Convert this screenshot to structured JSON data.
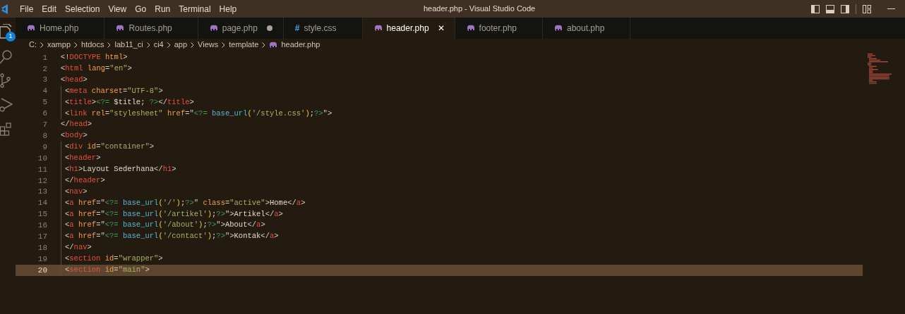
{
  "window": {
    "title": "header.php - Visual Studio Code"
  },
  "menu": [
    "File",
    "Edit",
    "Selection",
    "View",
    "Go",
    "Run",
    "Terminal",
    "Help"
  ],
  "activity_bar": {
    "badge": "1"
  },
  "tabs": [
    {
      "label": "Home.php",
      "kind": "php",
      "selected": false,
      "modified": false
    },
    {
      "label": "Routes.php",
      "kind": "php",
      "selected": false,
      "modified": false
    },
    {
      "label": "page.php",
      "kind": "php",
      "selected": false,
      "modified": true
    },
    {
      "label": "style.css",
      "kind": "css",
      "glyph": "#",
      "selected": false,
      "modified": false
    },
    {
      "label": "header.php",
      "kind": "php",
      "selected": true,
      "modified": false,
      "close": "✕"
    },
    {
      "label": "footer.php",
      "kind": "php",
      "selected": false,
      "modified": false
    },
    {
      "label": "about.php",
      "kind": "php",
      "selected": false,
      "modified": false
    }
  ],
  "breadcrumbs": [
    "C:",
    "xampp",
    "htdocs",
    "lab11_ci",
    "ci4",
    "app",
    "Views",
    "template",
    "header.php"
  ],
  "lines": [
    {
      "number": "1",
      "indented": false,
      "selected": false,
      "tokens": [
        {
          "kind": "punct",
          "text": "<!"
        },
        {
          "kind": "tag",
          "text": "DOCTYPE"
        },
        {
          "kind": "attr",
          "text": " html"
        },
        {
          "kind": "punct",
          "text": ">"
        }
      ]
    },
    {
      "number": "2",
      "indented": false,
      "selected": false,
      "tokens": [
        {
          "kind": "punct",
          "text": "<"
        },
        {
          "kind": "tag",
          "text": "html"
        },
        {
          "kind": "attr",
          "text": " lang"
        },
        {
          "kind": "punct",
          "text": "="
        },
        {
          "kind": "string",
          "text": "\"en\""
        },
        {
          "kind": "punct",
          "text": ">"
        }
      ]
    },
    {
      "number": "3",
      "indented": false,
      "selected": false,
      "tokens": [
        {
          "kind": "punct",
          "text": "<"
        },
        {
          "kind": "tag",
          "text": "head"
        },
        {
          "kind": "punct",
          "text": ">"
        }
      ]
    },
    {
      "number": "4",
      "indented": true,
      "selected": false,
      "tokens": [
        {
          "kind": "punct",
          "text": "<"
        },
        {
          "kind": "tag",
          "text": "meta"
        },
        {
          "kind": "attr",
          "text": " charset"
        },
        {
          "kind": "punct",
          "text": "="
        },
        {
          "kind": "string",
          "text": "\"UTF-8\""
        },
        {
          "kind": "punct",
          "text": ">"
        }
      ]
    },
    {
      "number": "5",
      "indented": true,
      "selected": false,
      "tokens": [
        {
          "kind": "punct",
          "text": "<"
        },
        {
          "kind": "tag",
          "text": "title"
        },
        {
          "kind": "punct",
          "text": ">"
        },
        {
          "kind": "php",
          "text": "<?="
        },
        {
          "kind": "text",
          "text": " $title; "
        },
        {
          "kind": "php",
          "text": "?>"
        },
        {
          "kind": "punct",
          "text": "</"
        },
        {
          "kind": "tag",
          "text": "title"
        },
        {
          "kind": "punct",
          "text": ">"
        }
      ]
    },
    {
      "number": "6",
      "indented": true,
      "selected": false,
      "tokens": [
        {
          "kind": "punct",
          "text": "<"
        },
        {
          "kind": "tag",
          "text": "link"
        },
        {
          "kind": "attr",
          "text": " rel"
        },
        {
          "kind": "punct",
          "text": "="
        },
        {
          "kind": "string",
          "text": "\"stylesheet\""
        },
        {
          "kind": "attr",
          "text": " href"
        },
        {
          "kind": "punct",
          "text": "=\""
        },
        {
          "kind": "php",
          "text": "<?="
        },
        {
          "kind": "func",
          "text": " base_url"
        },
        {
          "kind": "paren",
          "text": "("
        },
        {
          "kind": "string",
          "text": "'/style.css'"
        },
        {
          "kind": "paren",
          "text": ")"
        },
        {
          "kind": "text",
          "text": ";"
        },
        {
          "kind": "php",
          "text": "?>"
        },
        {
          "kind": "punct",
          "text": "\">"
        }
      ]
    },
    {
      "number": "7",
      "indented": false,
      "selected": false,
      "tokens": [
        {
          "kind": "punct",
          "text": "</"
        },
        {
          "kind": "tag",
          "text": "head"
        },
        {
          "kind": "punct",
          "text": ">"
        }
      ]
    },
    {
      "number": "8",
      "indented": false,
      "selected": false,
      "tokens": [
        {
          "kind": "punct",
          "text": "<"
        },
        {
          "kind": "tag",
          "text": "body"
        },
        {
          "kind": "punct",
          "text": ">"
        }
      ]
    },
    {
      "number": "9",
      "indented": true,
      "selected": false,
      "tokens": [
        {
          "kind": "punct",
          "text": "<"
        },
        {
          "kind": "tag",
          "text": "div"
        },
        {
          "kind": "attr",
          "text": " id"
        },
        {
          "kind": "punct",
          "text": "="
        },
        {
          "kind": "string",
          "text": "\"container\""
        },
        {
          "kind": "punct",
          "text": ">"
        }
      ]
    },
    {
      "number": "10",
      "indented": true,
      "selected": false,
      "tokens": [
        {
          "kind": "punct",
          "text": "<"
        },
        {
          "kind": "tag",
          "text": "header"
        },
        {
          "kind": "punct",
          "text": ">"
        }
      ]
    },
    {
      "number": "11",
      "indented": true,
      "selected": false,
      "tokens": [
        {
          "kind": "punct",
          "text": "<"
        },
        {
          "kind": "tag",
          "text": "h1"
        },
        {
          "kind": "punct",
          "text": ">"
        },
        {
          "kind": "text",
          "text": "Layout Sederhana"
        },
        {
          "kind": "punct",
          "text": "</"
        },
        {
          "kind": "tag",
          "text": "h1"
        },
        {
          "kind": "punct",
          "text": ">"
        }
      ]
    },
    {
      "number": "12",
      "indented": true,
      "selected": false,
      "tokens": [
        {
          "kind": "punct",
          "text": "</"
        },
        {
          "kind": "tag",
          "text": "header"
        },
        {
          "kind": "punct",
          "text": ">"
        }
      ]
    },
    {
      "number": "13",
      "indented": true,
      "selected": false,
      "tokens": [
        {
          "kind": "punct",
          "text": "<"
        },
        {
          "kind": "tag",
          "text": "nav"
        },
        {
          "kind": "punct",
          "text": ">"
        }
      ]
    },
    {
      "number": "14",
      "indented": true,
      "selected": false,
      "tokens": [
        {
          "kind": "punct",
          "text": "<"
        },
        {
          "kind": "tag",
          "text": "a"
        },
        {
          "kind": "attr",
          "text": " href"
        },
        {
          "kind": "punct",
          "text": "=\""
        },
        {
          "kind": "php",
          "text": "<?="
        },
        {
          "kind": "func",
          "text": " base_url"
        },
        {
          "kind": "paren",
          "text": "("
        },
        {
          "kind": "string",
          "text": "'/'"
        },
        {
          "kind": "paren",
          "text": ")"
        },
        {
          "kind": "text",
          "text": ";"
        },
        {
          "kind": "php",
          "text": "?>"
        },
        {
          "kind": "punct",
          "text": "\""
        },
        {
          "kind": "attr",
          "text": " class"
        },
        {
          "kind": "punct",
          "text": "="
        },
        {
          "kind": "string",
          "text": "\"active\""
        },
        {
          "kind": "punct",
          "text": ">"
        },
        {
          "kind": "text",
          "text": "Home"
        },
        {
          "kind": "punct",
          "text": "</"
        },
        {
          "kind": "tag",
          "text": "a"
        },
        {
          "kind": "punct",
          "text": ">"
        }
      ]
    },
    {
      "number": "15",
      "indented": true,
      "selected": false,
      "tokens": [
        {
          "kind": "punct",
          "text": "<"
        },
        {
          "kind": "tag",
          "text": "a"
        },
        {
          "kind": "attr",
          "text": " href"
        },
        {
          "kind": "punct",
          "text": "=\""
        },
        {
          "kind": "php",
          "text": "<?="
        },
        {
          "kind": "func",
          "text": " base_url"
        },
        {
          "kind": "paren",
          "text": "("
        },
        {
          "kind": "string",
          "text": "'/artikel'"
        },
        {
          "kind": "paren",
          "text": ")"
        },
        {
          "kind": "text",
          "text": ";"
        },
        {
          "kind": "php",
          "text": "?>"
        },
        {
          "kind": "punct",
          "text": "\">"
        },
        {
          "kind": "text",
          "text": "Artikel"
        },
        {
          "kind": "punct",
          "text": "</"
        },
        {
          "kind": "tag",
          "text": "a"
        },
        {
          "kind": "punct",
          "text": ">"
        }
      ]
    },
    {
      "number": "16",
      "indented": true,
      "selected": false,
      "tokens": [
        {
          "kind": "punct",
          "text": "<"
        },
        {
          "kind": "tag",
          "text": "a"
        },
        {
          "kind": "attr",
          "text": " href"
        },
        {
          "kind": "punct",
          "text": "=\""
        },
        {
          "kind": "php",
          "text": "<?="
        },
        {
          "kind": "func",
          "text": " base_url"
        },
        {
          "kind": "paren",
          "text": "("
        },
        {
          "kind": "string",
          "text": "'/about'"
        },
        {
          "kind": "paren",
          "text": ")"
        },
        {
          "kind": "text",
          "text": ";"
        },
        {
          "kind": "php",
          "text": "?>"
        },
        {
          "kind": "punct",
          "text": "\">"
        },
        {
          "kind": "text",
          "text": "About"
        },
        {
          "kind": "punct",
          "text": "</"
        },
        {
          "kind": "tag",
          "text": "a"
        },
        {
          "kind": "punct",
          "text": ">"
        }
      ]
    },
    {
      "number": "17",
      "indented": true,
      "selected": false,
      "tokens": [
        {
          "kind": "punct",
          "text": "<"
        },
        {
          "kind": "tag",
          "text": "a"
        },
        {
          "kind": "attr",
          "text": " href"
        },
        {
          "kind": "punct",
          "text": "=\""
        },
        {
          "kind": "php",
          "text": "<?="
        },
        {
          "kind": "func",
          "text": " base_url"
        },
        {
          "kind": "paren",
          "text": "("
        },
        {
          "kind": "string",
          "text": "'/contact'"
        },
        {
          "kind": "paren",
          "text": ")"
        },
        {
          "kind": "text",
          "text": ";"
        },
        {
          "kind": "php",
          "text": "?>"
        },
        {
          "kind": "punct",
          "text": "\">"
        },
        {
          "kind": "text",
          "text": "Kontak"
        },
        {
          "kind": "punct",
          "text": "</"
        },
        {
          "kind": "tag",
          "text": "a"
        },
        {
          "kind": "punct",
          "text": ">"
        }
      ]
    },
    {
      "number": "18",
      "indented": true,
      "selected": false,
      "tokens": [
        {
          "kind": "punct",
          "text": "</"
        },
        {
          "kind": "tag",
          "text": "nav"
        },
        {
          "kind": "punct",
          "text": ">"
        }
      ]
    },
    {
      "number": "19",
      "indented": true,
      "selected": false,
      "tokens": [
        {
          "kind": "punct",
          "text": "<"
        },
        {
          "kind": "tag",
          "text": "section"
        },
        {
          "kind": "attr",
          "text": " id"
        },
        {
          "kind": "punct",
          "text": "="
        },
        {
          "kind": "string",
          "text": "\"wrapper\""
        },
        {
          "kind": "punct",
          "text": ">"
        }
      ]
    },
    {
      "number": "20",
      "indented": true,
      "selected": true,
      "tokens": [
        {
          "kind": "punct",
          "text": "<"
        },
        {
          "kind": "tag",
          "text": "section"
        },
        {
          "kind": "attr",
          "text": " id"
        },
        {
          "kind": "punct",
          "text": "="
        },
        {
          "kind": "string",
          "text": "\"main\""
        },
        {
          "kind": "punct",
          "text": ">"
        }
      ]
    }
  ]
}
